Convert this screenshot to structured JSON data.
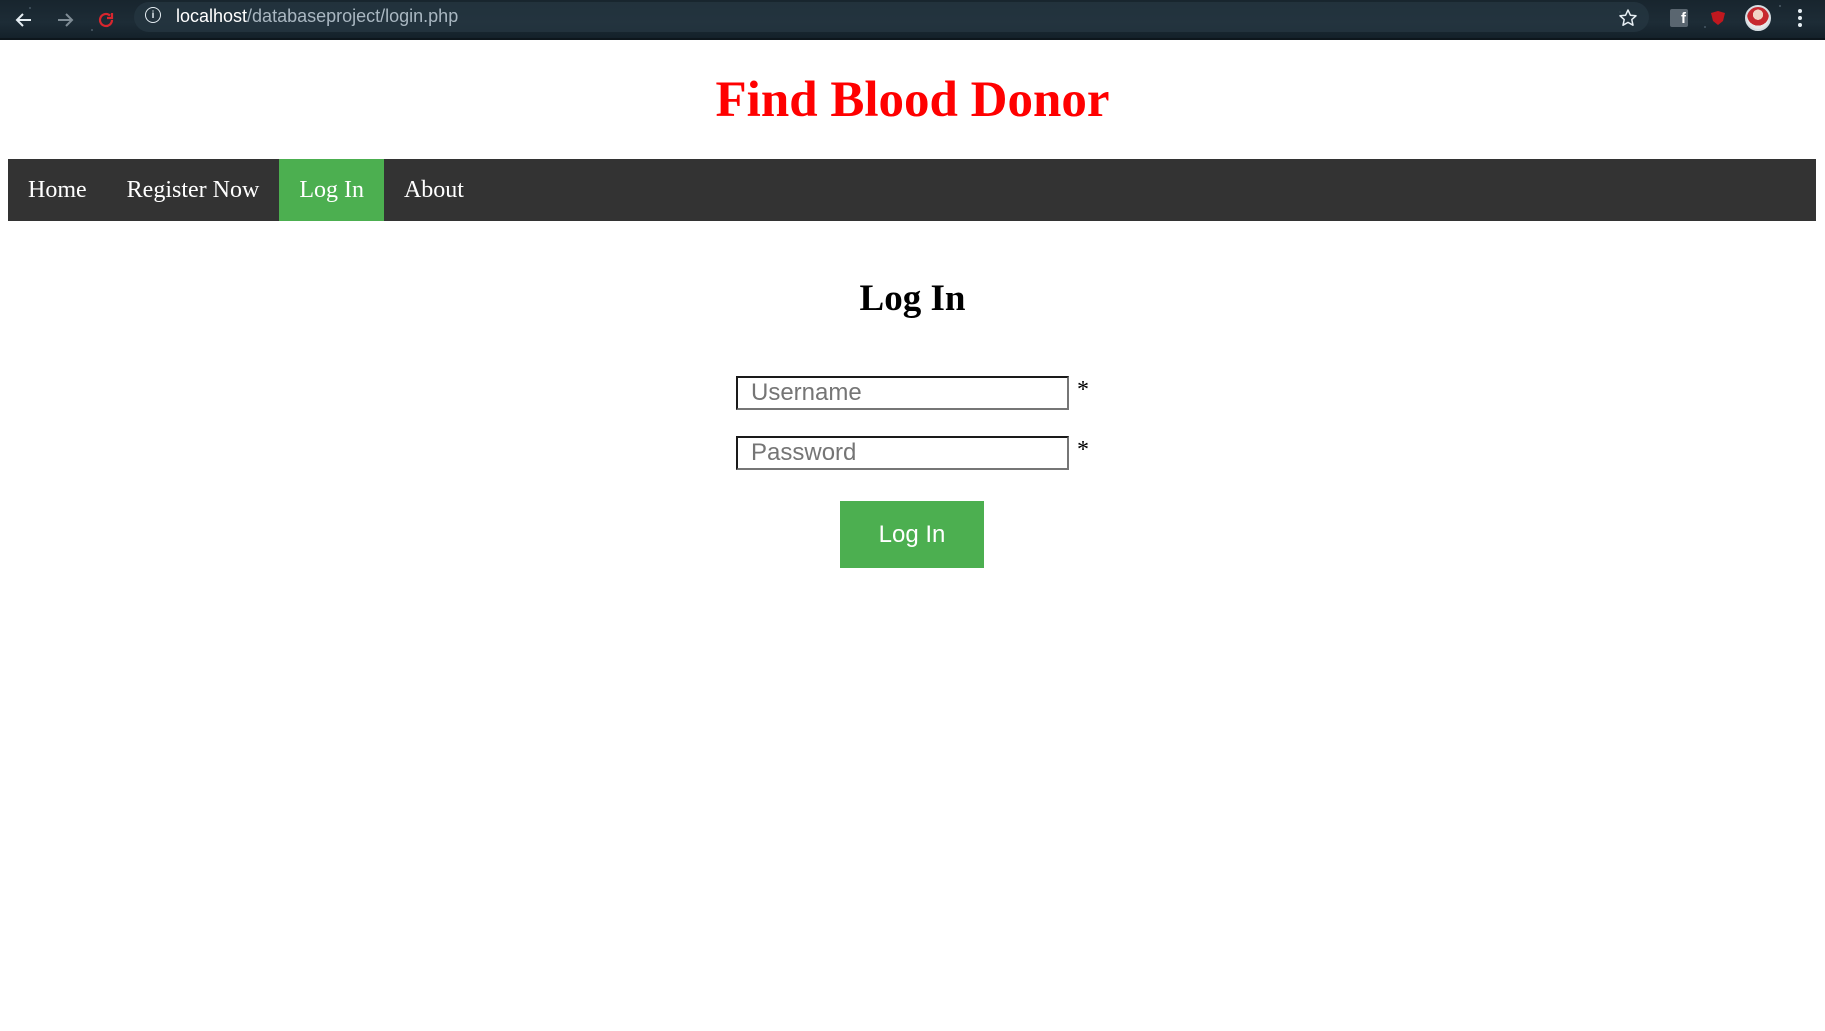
{
  "browser": {
    "url_host": "localhost",
    "url_path": "/databaseproject/login.php",
    "info_glyph": "i",
    "icons": [
      "back-arrow-icon",
      "forward-arrow-icon",
      "reload-icon",
      "info-icon",
      "star-icon",
      "facebook-extension-icon",
      "red-extension-icon",
      "profile-avatar-icon",
      "menu-kebab-icon"
    ],
    "fb_glyph": "f"
  },
  "site": {
    "title": "Find Blood Donor",
    "title_color": "#ff0000"
  },
  "nav": {
    "items": [
      {
        "label": "Home",
        "active": false
      },
      {
        "label": "Register Now",
        "active": false
      },
      {
        "label": "Log In",
        "active": true
      },
      {
        "label": "About",
        "active": false
      }
    ],
    "bar_color": "#333333",
    "active_color": "#4caf50"
  },
  "login_form": {
    "heading": "Log In",
    "username_placeholder": "Username",
    "password_placeholder": "Password",
    "required_marker": "*",
    "submit_label": "Log In",
    "button_color": "#4caf50"
  }
}
